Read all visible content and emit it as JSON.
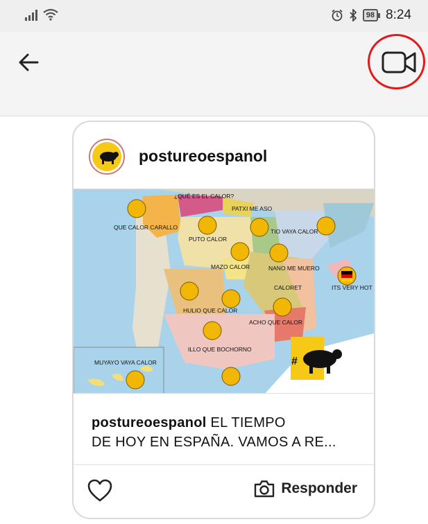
{
  "status_bar": {
    "battery": "98",
    "time": "8:24"
  },
  "nav": {
    "back_icon": "arrow-left-icon",
    "video_icon": "video-camera-icon",
    "highlight_color": "#e01a1a"
  },
  "post": {
    "username": "postureoespanol",
    "caption_user": "postureoespanol",
    "caption_line1": " EL TIEMPO",
    "caption_line2": "DE HOY EN ESPAÑA. VAMOS A RE...",
    "reply_label": "Responder",
    "map_labels": {
      "galicia": "QUE CALOR CARALLO",
      "asturias": "¿QUÉ ES EL CALOR?",
      "pais_vasco": "PATXI ME ASO",
      "aragon": "TIO VAYA CALOR",
      "castilla_leon": "PUTO CALOR",
      "madrid": "MAZO CALOR",
      "castilla_mancha": "NANO ME MUERO",
      "valencia": "CALORET",
      "baleares": "ITS VERY HOT",
      "extremadura": "HULIO QUE CALOR",
      "murcia": "ACHO QUE CALOR",
      "andalucia": "ILLO QUE BOCHORNO",
      "canarias": "MUYAYO VAYA CALOR",
      "logo_hash": "#"
    }
  }
}
